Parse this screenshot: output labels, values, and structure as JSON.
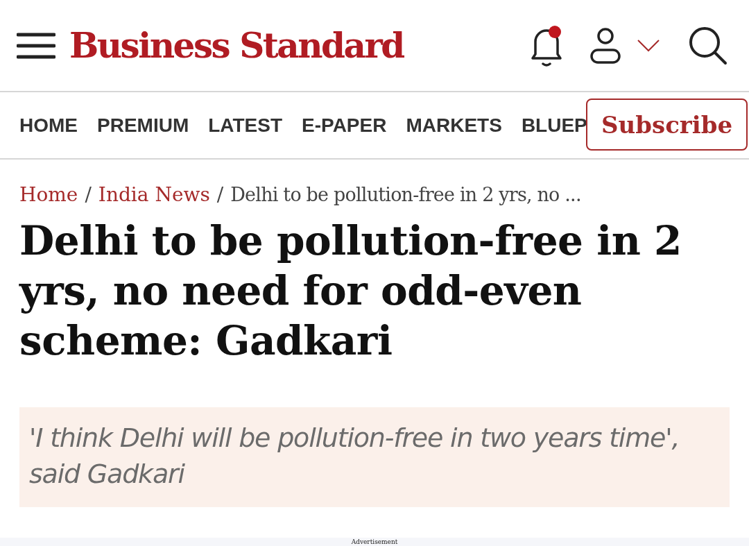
{
  "header": {
    "logo": "Business Standard",
    "notification_dot": true
  },
  "nav": {
    "items": [
      {
        "label": "HOME"
      },
      {
        "label": "PREMIUM"
      },
      {
        "label": "LATEST"
      },
      {
        "label": "E-PAPER"
      },
      {
        "label": "MARKETS"
      },
      {
        "label": "BLUEP"
      }
    ],
    "subscribe": "Subscribe"
  },
  "breadcrumb": [
    {
      "kind": "link",
      "label": "Home"
    },
    {
      "kind": "separator",
      "label": "/"
    },
    {
      "kind": "link",
      "label": "India News"
    },
    {
      "kind": "separator",
      "label": "/"
    },
    {
      "kind": "current",
      "label": "Delhi to be pollution-free in 2 yrs, no ..."
    }
  ],
  "headline": "Delhi to be pollution-free in 2 yrs, no need for odd-even scheme: Gadkari",
  "summary": "'I think Delhi will be pollution-free in two years time', said Gadkari",
  "ad_label": "Advertisement"
}
